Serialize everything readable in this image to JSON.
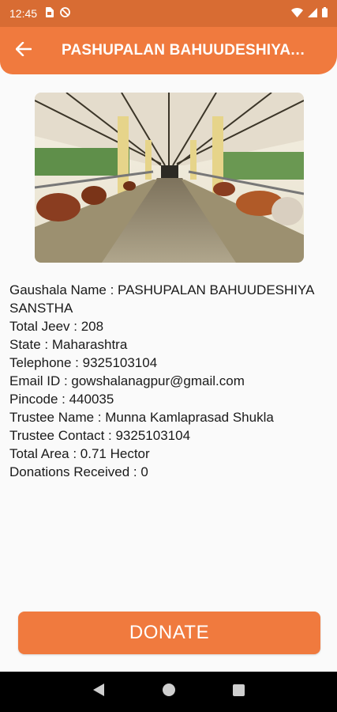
{
  "status_bar": {
    "time": "12:45",
    "icons_left": [
      "sim-card-icon",
      "no-disturb-icon"
    ],
    "icons_right": [
      "wifi-icon",
      "signal-icon",
      "battery-icon"
    ]
  },
  "app_bar": {
    "back_icon": "arrow-back-icon",
    "title": "PASHUPALAN BAHUUDESHIYA SANSTHA"
  },
  "hero_image": {
    "alt": "cow shed photo"
  },
  "details": {
    "gaushala_name": "Gaushala Name : PASHUPALAN BAHUUDESHIYA SANSTHA",
    "total_jeev": "Total Jeev :  208",
    "state": "State : Maharashtra",
    "telephone": "Telephone :  9325103104",
    "email": "Email ID : gowshalanagpur@gmail.com",
    "pincode": "Pincode : 440035",
    "trustee_name": "Trustee Name : Munna Kamlaprasad Shukla",
    "trustee_contact": "Trustee Contact : 9325103104",
    "total_area": "Total Area : 0.71 Hector",
    "donations": "Donations Received :  0"
  },
  "donate_button": {
    "label": "DONATE"
  },
  "colors": {
    "primary": "#f07a3e",
    "status_bar": "#d86c33",
    "nav_bar": "#000000"
  },
  "nav_bar": {
    "icons": [
      "back-triangle-icon",
      "home-circle-icon",
      "recents-square-icon"
    ]
  }
}
